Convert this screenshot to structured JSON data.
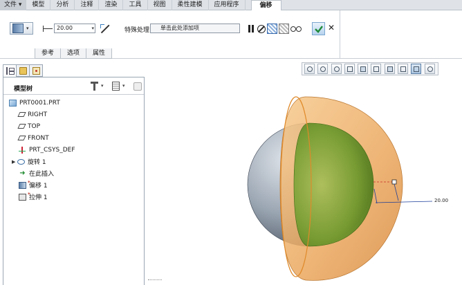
{
  "menubar": {
    "tabs": [
      {
        "label": "文件",
        "arrow": "▾"
      },
      {
        "label": "模型"
      },
      {
        "label": "分析"
      },
      {
        "label": "注释"
      },
      {
        "label": "渲染"
      },
      {
        "label": "工具"
      },
      {
        "label": "视图"
      },
      {
        "label": "柔性建模"
      },
      {
        "label": "应用程序"
      },
      {
        "label": "偏移"
      }
    ]
  },
  "ribbon": {
    "feature_type_arrow": "▾",
    "dimension": {
      "value": "20.00",
      "dropdown_arrow": "▾"
    },
    "special_handling": {
      "label": "特殊处理",
      "placeholder": "单击此处添加项"
    },
    "subtabs": [
      "参考",
      "选项",
      "属性"
    ],
    "close_label": "✕"
  },
  "navigator": {
    "title": "模型树",
    "arrow": "▾"
  },
  "model_tree": [
    {
      "label": "PRT0001.PRT",
      "icon": "part-icon",
      "expandable": false
    },
    {
      "label": "RIGHT",
      "icon": "datum-plane-icon",
      "expandable": false
    },
    {
      "label": "TOP",
      "icon": "datum-plane-icon",
      "expandable": false
    },
    {
      "label": "FRONT",
      "icon": "datum-plane-icon",
      "expandable": false
    },
    {
      "label": "PRT_CSYS_DEF",
      "icon": "csys-icon",
      "expandable": false
    },
    {
      "label": "旋转 1",
      "icon": "revolve-icon",
      "expandable": true,
      "expander": "▶"
    },
    {
      "label": "在此插入",
      "icon": "insert-arrow-icon",
      "expandable": false,
      "glyph": "➜"
    },
    {
      "label": "偏移 1",
      "icon": "offset-icon",
      "expandable": false,
      "mark": "*"
    },
    {
      "label": "拉伸 1",
      "icon": "extrude-icon",
      "expandable": false,
      "mark": "*"
    }
  ],
  "viewport": {
    "dimension_label": "20.00",
    "colors": {
      "sphere": "#8e9aa8",
      "offset_shell": "#f0b46c",
      "inner_green": "#6f9a2e",
      "background": "#ffffff"
    }
  }
}
